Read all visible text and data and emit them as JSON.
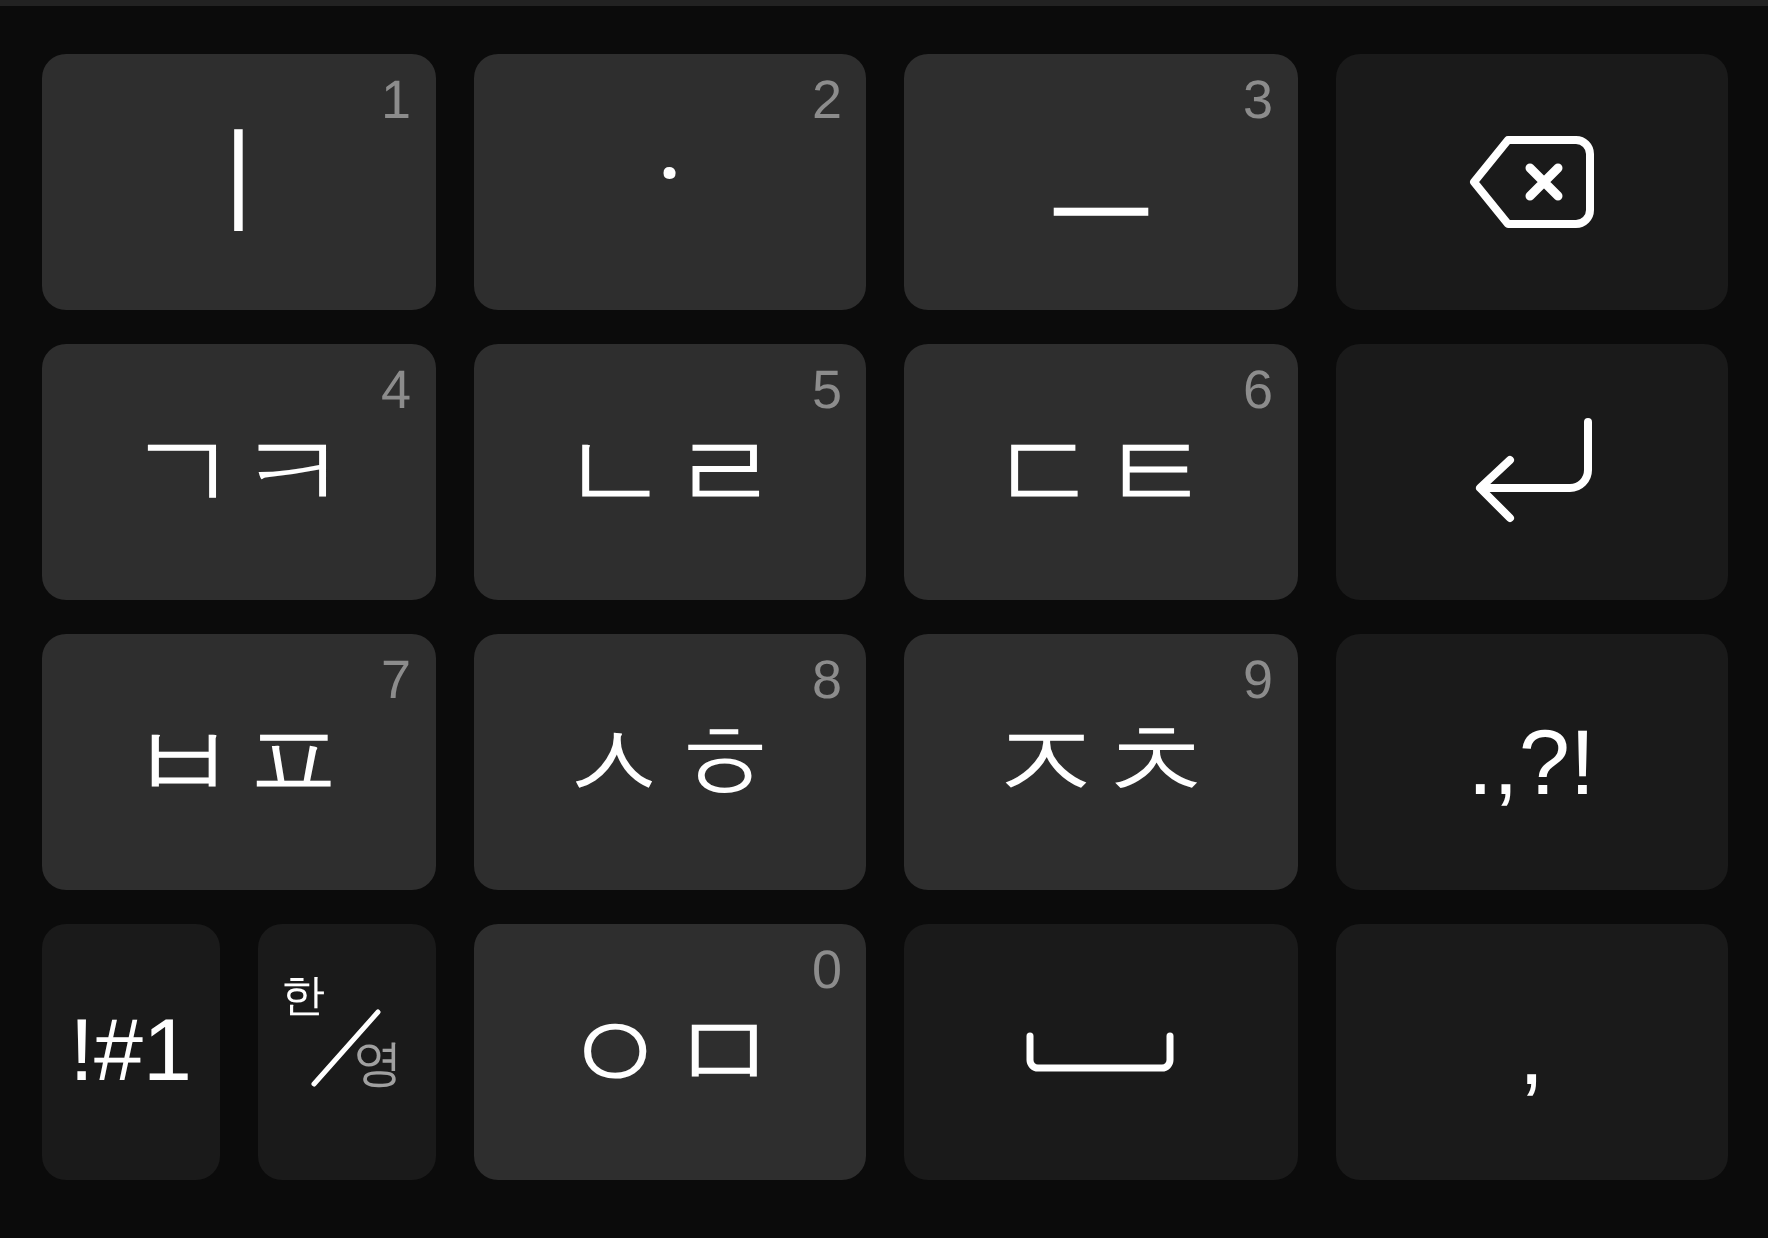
{
  "keyboard": {
    "rows": [
      {
        "keys": [
          {
            "kind": "vowel",
            "label": "ㅣ",
            "hint": "1"
          },
          {
            "kind": "vowel",
            "label": "ㆍ",
            "hint": "2"
          },
          {
            "kind": "vowel",
            "label": "ㅡ",
            "hint": "3"
          },
          {
            "kind": "backspace"
          }
        ]
      },
      {
        "keys": [
          {
            "kind": "consonant",
            "label": "ㄱㅋ",
            "hint": "4"
          },
          {
            "kind": "consonant",
            "label": "ㄴㄹ",
            "hint": "5"
          },
          {
            "kind": "consonant",
            "label": "ㄷㅌ",
            "hint": "6"
          },
          {
            "kind": "enter"
          }
        ]
      },
      {
        "keys": [
          {
            "kind": "consonant",
            "label": "ㅂㅍ",
            "hint": "7"
          },
          {
            "kind": "consonant",
            "label": "ㅅㅎ",
            "hint": "8"
          },
          {
            "kind": "consonant",
            "label": "ㅈㅊ",
            "hint": "9"
          },
          {
            "kind": "symbol",
            "label": ".,?!"
          }
        ]
      },
      {
        "keys": [
          {
            "kind": "mode",
            "label": "!#1"
          },
          {
            "kind": "lang",
            "top": "한",
            "bottom": "영"
          },
          {
            "kind": "consonant",
            "label": "ㅇㅁ",
            "hint": "0"
          },
          {
            "kind": "space"
          },
          {
            "kind": "symbol",
            "label": ","
          }
        ]
      }
    ]
  }
}
